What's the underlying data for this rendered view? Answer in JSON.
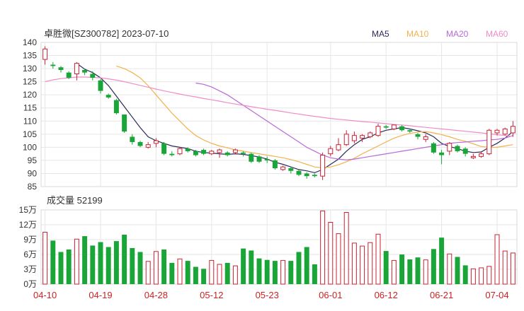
{
  "chart_data": [
    {
      "type": "candlestick",
      "title": "卓胜微[SZ300782] 2023-07-10",
      "legend": [
        {
          "name": "MA5",
          "color": "#2a2a5a"
        },
        {
          "name": "MA10",
          "color": "#f2b24c"
        },
        {
          "name": "MA20",
          "color": "#b86ad6"
        },
        {
          "name": "MA60",
          "color": "#f08cc8"
        }
      ],
      "legend_position": "top-right",
      "ylim": [
        85,
        140
      ],
      "yticks": [
        "140",
        "135",
        "130",
        "125",
        "120",
        "115",
        "110",
        "105",
        "100",
        "95",
        "90",
        "85"
      ],
      "up_color": "#cc2233",
      "down_color": "#19a538",
      "candles": [
        [
          133.5,
          137.5,
          138.5,
          131.5
        ],
        [
          131.5,
          131.0,
          132.5,
          130.0
        ],
        [
          130.5,
          129.5,
          131.0,
          128.5
        ],
        [
          128.5,
          126.5,
          129.0,
          126.0
        ],
        [
          128.0,
          132.0,
          132.5,
          125.5
        ],
        [
          129.5,
          128.5,
          130.0,
          127.5
        ],
        [
          128.0,
          126.5,
          129.0,
          125.5
        ],
        [
          125.5,
          121.5,
          126.0,
          120.5
        ],
        [
          120.0,
          119.0,
          120.5,
          118.5
        ],
        [
          118.0,
          113.0,
          118.5,
          112.5
        ],
        [
          112.5,
          106.0,
          112.5,
          105.5
        ],
        [
          104.0,
          102.0,
          105.0,
          101.0
        ],
        [
          102.0,
          100.5,
          102.5,
          100.0
        ],
        [
          100.0,
          101.0,
          102.0,
          99.5
        ],
        [
          101.5,
          102.5,
          103.5,
          100.0
        ],
        [
          101.5,
          97.5,
          102.0,
          97.0
        ],
        [
          97.5,
          97.0,
          98.5,
          96.5
        ],
        [
          97.5,
          99.5,
          100.0,
          97.0
        ],
        [
          99.5,
          98.5,
          100.0,
          98.0
        ],
        [
          98.5,
          97.0,
          99.0,
          96.5
        ],
        [
          99.0,
          97.5,
          99.5,
          97.0
        ],
        [
          97.5,
          98.5,
          99.0,
          97.0
        ],
        [
          98.0,
          99.0,
          99.5,
          96.0
        ],
        [
          98.0,
          97.0,
          98.5,
          96.5
        ],
        [
          98.0,
          99.0,
          99.5,
          97.5
        ],
        [
          98.0,
          97.5,
          98.5,
          96.5
        ],
        [
          97.5,
          94.5,
          98.0,
          94.0
        ],
        [
          96.5,
          94.5,
          97.0,
          94.0
        ],
        [
          95.5,
          95.0,
          96.5,
          94.0
        ],
        [
          95.0,
          92.0,
          95.5,
          91.5
        ],
        [
          91.5,
          92.5,
          93.0,
          91.0
        ],
        [
          92.0,
          91.0,
          92.5,
          90.0
        ],
        [
          91.0,
          89.5,
          91.5,
          89.0
        ],
        [
          90.0,
          89.0,
          90.5,
          88.0
        ],
        [
          89.5,
          89.0,
          90.0,
          88.5
        ],
        [
          89.0,
          97.0,
          98.0,
          87.5
        ],
        [
          97.5,
          99.5,
          100.5,
          96.5
        ],
        [
          99.0,
          101.0,
          103.5,
          98.5
        ],
        [
          101.0,
          105.0,
          106.5,
          100.5
        ],
        [
          102.5,
          104.5,
          106.0,
          101.5
        ],
        [
          103.5,
          104.5,
          105.0,
          102.0
        ],
        [
          104.0,
          105.5,
          106.0,
          103.5
        ],
        [
          104.5,
          108.0,
          109.0,
          104.0
        ],
        [
          108.0,
          107.5,
          108.5,
          107.0
        ],
        [
          107.0,
          108.5,
          108.5,
          106.5
        ],
        [
          108.0,
          106.5,
          108.5,
          106.0
        ],
        [
          106.5,
          106.0,
          107.0,
          105.5
        ],
        [
          105.0,
          104.0,
          105.5,
          103.0
        ],
        [
          103.0,
          104.0,
          105.0,
          102.0
        ],
        [
          101.5,
          98.0,
          102.0,
          97.5
        ],
        [
          98.0,
          97.0,
          99.0,
          93.5
        ],
        [
          98.5,
          101.5,
          102.0,
          97.0
        ],
        [
          100.5,
          98.5,
          101.0,
          98.0
        ],
        [
          99.5,
          97.5,
          100.0,
          96.5
        ],
        [
          96.0,
          96.5,
          97.5,
          95.5
        ],
        [
          96.5,
          97.5,
          98.5,
          96.0
        ],
        [
          97.5,
          106.5,
          107.0,
          97.0
        ],
        [
          105.5,
          106.5,
          107.0,
          104.5
        ],
        [
          105.0,
          107.0,
          107.5,
          104.5
        ],
        [
          105.5,
          108.0,
          110.0,
          104.0
        ]
      ],
      "ma": {
        "MA5": [
          null,
          null,
          null,
          null,
          132.0,
          129.8,
          128.5,
          126.5,
          123.5,
          119.5,
          115.5,
          111.5,
          107.5,
          104.0,
          102.5,
          101.5,
          100.5,
          100.0,
          99.5,
          98.5,
          98.0,
          97.8,
          97.5,
          97.3,
          97.5,
          97.3,
          96.8,
          96.3,
          95.5,
          94.3,
          93.5,
          92.5,
          91.5,
          91.0,
          90.3,
          91.5,
          93.5,
          95.5,
          98.5,
          101.0,
          103.0,
          104.0,
          105.5,
          106.5,
          107.0,
          107.5,
          107.0,
          106.3,
          105.5,
          104.0,
          101.5,
          100.3,
          99.5,
          98.5,
          98.0,
          98.2,
          100.0,
          101.5,
          103.5,
          106.0
        ],
        "MA10": [
          null,
          null,
          null,
          null,
          null,
          null,
          null,
          null,
          null,
          131.0,
          130.0,
          128.5,
          126.5,
          123.5,
          120.0,
          116.5,
          113.0,
          110.0,
          107.0,
          104.5,
          102.8,
          101.5,
          100.5,
          99.8,
          99.0,
          98.5,
          98.0,
          97.5,
          97.0,
          96.5,
          96.0,
          95.3,
          94.5,
          93.5,
          92.5,
          92.2,
          92.5,
          93.3,
          94.5,
          95.8,
          97.5,
          99.0,
          100.5,
          102.0,
          103.5,
          104.5,
          105.3,
          105.8,
          106.0,
          105.5,
          104.8,
          104.0,
          103.0,
          102.3,
          101.3,
          100.3,
          100.0,
          100.0,
          100.5,
          101.0
        ],
        "MA20": [
          null,
          null,
          null,
          null,
          null,
          null,
          null,
          null,
          null,
          null,
          null,
          null,
          null,
          null,
          null,
          null,
          null,
          null,
          null,
          124.5,
          124.0,
          123.0,
          121.5,
          120.0,
          118.0,
          116.0,
          114.0,
          112.0,
          110.0,
          108.0,
          106.0,
          104.0,
          102.0,
          100.0,
          98.5,
          97.0,
          96.0,
          95.5,
          95.2,
          95.5,
          96.0,
          96.5,
          97.0,
          97.5,
          98.0,
          98.5,
          99.0,
          99.5,
          100.0,
          100.5,
          101.0,
          101.5,
          101.8,
          102.0,
          102.3,
          102.5,
          102.8,
          103.0,
          103.5,
          104.5
        ],
        "MA60": [
          125.0,
          125.7,
          126.2,
          126.5,
          126.8,
          126.8,
          126.7,
          126.5,
          126.1,
          125.6,
          125.0,
          124.3,
          123.6,
          122.9,
          122.2,
          121.5,
          120.9,
          120.3,
          119.7,
          119.2,
          118.6,
          118.1,
          117.6,
          117.0,
          116.5,
          116.0,
          115.5,
          115.0,
          114.5,
          114.1,
          113.6,
          113.1,
          112.7,
          112.2,
          111.8,
          111.4,
          111.0,
          110.7,
          110.4,
          110.1,
          109.8,
          109.6,
          109.3,
          109.0,
          108.7,
          108.5,
          108.2,
          107.9,
          107.6,
          107.3,
          107.0,
          106.7,
          106.4,
          106.1,
          105.8,
          105.5,
          105.2,
          104.8,
          104.5,
          104.2
        ]
      },
      "x_tick_labels": [
        {
          "index": 0,
          "label": "04-10"
        },
        {
          "index": 7,
          "label": "04-19"
        },
        {
          "index": 14,
          "label": "04-28"
        },
        {
          "index": 21,
          "label": "05-12"
        },
        {
          "index": 28,
          "label": "05-23"
        },
        {
          "index": 36,
          "label": "06-01"
        },
        {
          "index": 43,
          "label": "06-12"
        },
        {
          "index": 50,
          "label": "06-21"
        },
        {
          "index": 57,
          "label": "07-04"
        }
      ]
    },
    {
      "type": "bar",
      "title": "成交量 52199",
      "ylim": [
        0,
        150000
      ],
      "yticks": [
        "15万",
        "12万",
        "9万",
        "6万",
        "3万",
        "0万"
      ],
      "volumes": [
        105000,
        88000,
        65000,
        70000,
        91000,
        97000,
        78000,
        85000,
        75000,
        87000,
        100000,
        73000,
        65000,
        46000,
        66000,
        70000,
        43000,
        51000,
        47000,
        35000,
        31000,
        48000,
        40000,
        43000,
        37000,
        72000,
        68000,
        52000,
        49000,
        47000,
        48000,
        47000,
        65000,
        75000,
        40000,
        148000,
        125000,
        102000,
        145000,
        83000,
        77000,
        84000,
        101000,
        67000,
        48000,
        60000,
        50000,
        54000,
        49000,
        71000,
        94000,
        61000,
        55000,
        38000,
        31000,
        33000,
        36000,
        100000,
        67000,
        63000
      ]
    }
  ],
  "x_labels": [
    "04-10",
    "04-19",
    "04-28",
    "05-12",
    "05-23",
    "06-01",
    "06-12",
    "06-21",
    "07-04"
  ]
}
